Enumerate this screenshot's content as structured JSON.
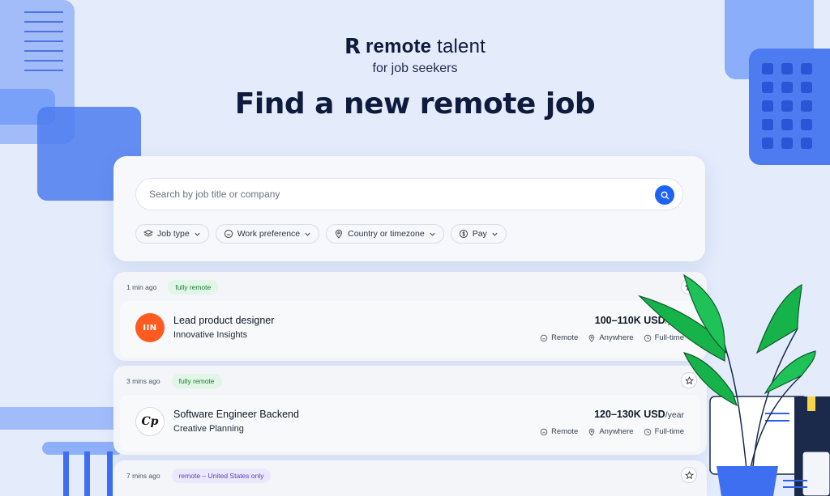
{
  "brand": {
    "name_bold": "remote",
    "name_light": " talent",
    "tagline": "for job seekers"
  },
  "headline": "Find a new remote job",
  "search": {
    "placeholder": "Search by job title or company"
  },
  "filters": [
    {
      "label": "Job type",
      "icon": "layers-icon"
    },
    {
      "label": "Work preference",
      "icon": "home-icon"
    },
    {
      "label": "Country or timezone",
      "icon": "map-pin-icon"
    },
    {
      "label": "Pay",
      "icon": "dollar-icon"
    }
  ],
  "jobs": [
    {
      "posted": "1 min ago",
      "tag": "fully remote",
      "logo": "IIN",
      "title": "Lead product designer",
      "company": "Innovative Insights",
      "salary": "100–110K USD",
      "period": "/year",
      "work": "Remote",
      "location": "Anywhere",
      "type": "Full-time"
    },
    {
      "posted": "3 mins ago",
      "tag": "fully remote",
      "logo": "Cp",
      "title": "Software Engineer Backend",
      "company": "Creative Planning",
      "salary": "120–130K USD",
      "period": "/year",
      "work": "Remote",
      "location": "Anywhere",
      "type": "Full-time"
    },
    {
      "posted": "7 mins ago",
      "tag": "remote – United States only"
    }
  ],
  "colors": {
    "accent": "#1f63f5",
    "background": "#e4ecfc",
    "tag_green_bg": "#e1f6e6",
    "tag_purple_bg": "#ece8fb",
    "logo_orange": "#ff5a1f",
    "plant_green": "#16b34a"
  }
}
